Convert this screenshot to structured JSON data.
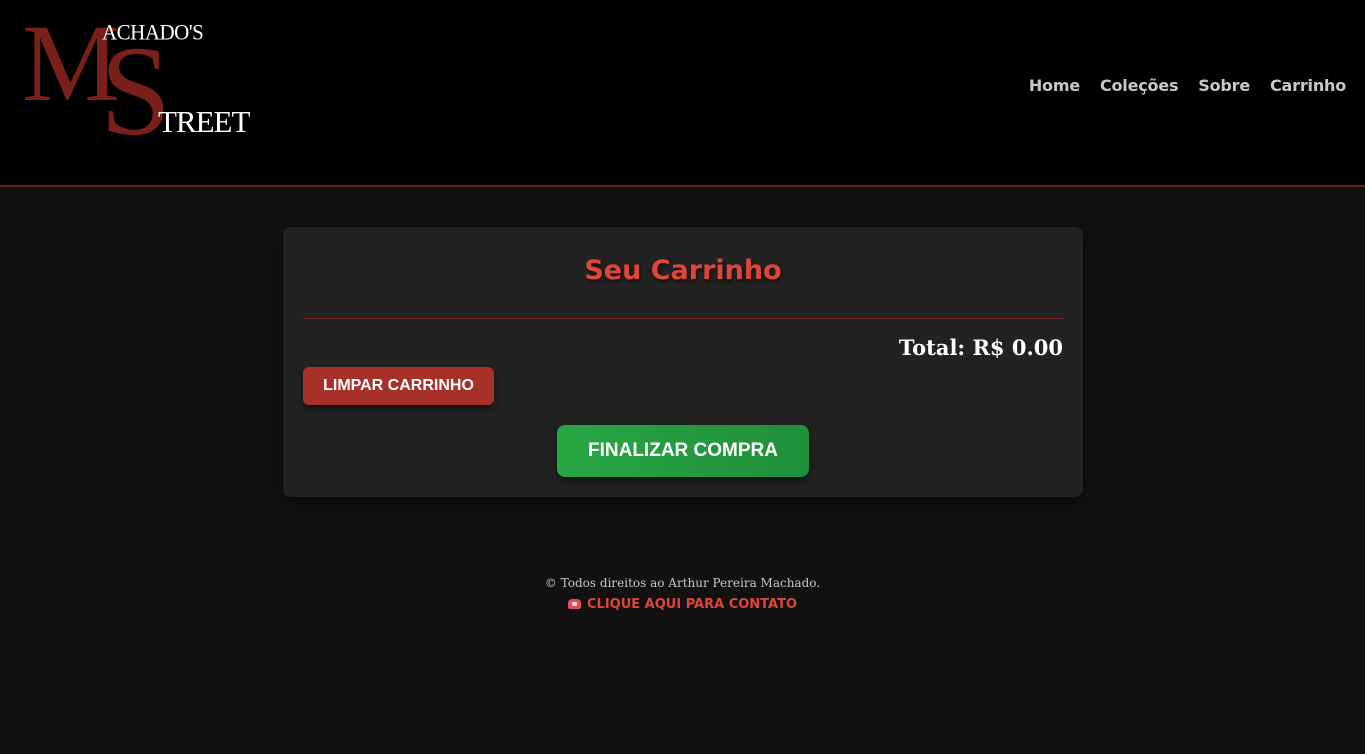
{
  "logo": {
    "big_m": "M",
    "big_s": "S",
    "top_text": "ACHADO'S",
    "bottom_text": "TREET",
    "color": "#7a201b"
  },
  "nav": {
    "items": [
      {
        "label": "Home"
      },
      {
        "label": "Coleções"
      },
      {
        "label": "Sobre"
      },
      {
        "label": "Carrinho"
      }
    ]
  },
  "cart": {
    "title": "Seu Carrinho",
    "total": "Total: R$ 0.00",
    "clear_label": "LIMPAR CARRINHO",
    "checkout_label": "FINALIZAR COMPRA"
  },
  "footer": {
    "copyright": "© Todos direitos ao Arthur Pereira Machado.",
    "contact_label": "CLIQUE AQUI PARA CONTATO"
  },
  "colors": {
    "accent": "#e0453a",
    "danger": "#a8302a",
    "success": "#28a745",
    "background": "#111111",
    "header": "#000000",
    "card": "#222222"
  },
  "icons": {
    "contact": "telephone-icon"
  }
}
